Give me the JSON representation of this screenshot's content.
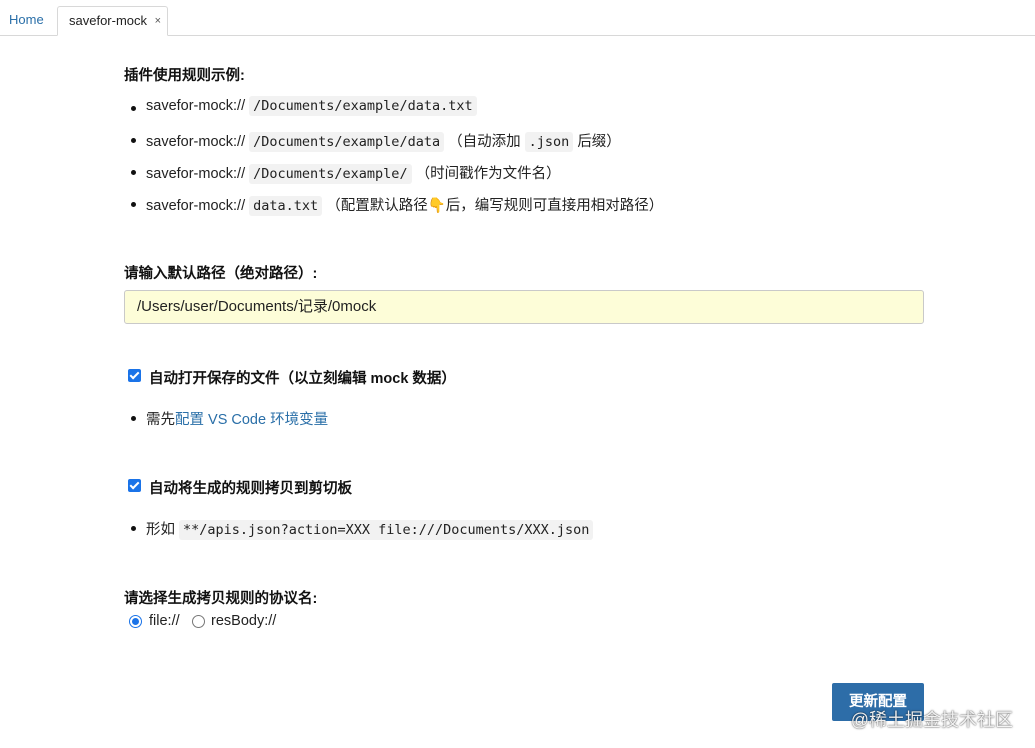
{
  "tabs": {
    "home": "Home",
    "active": "savefor-mock",
    "close": "×"
  },
  "examples": {
    "heading": "插件使用规则示例:",
    "items": [
      {
        "prefix": "savefor-mock://",
        "code": "/Documents/example/data.txt",
        "note": "",
        "code2": "",
        "note2": ""
      },
      {
        "prefix": "savefor-mock://",
        "code": "/Documents/example/data",
        "note": "（自动添加",
        "code2": ".json",
        "note2": "后缀）"
      },
      {
        "prefix": "savefor-mock://",
        "code": "/Documents/example/",
        "note": "（时间戳作为文件名）",
        "code2": "",
        "note2": ""
      },
      {
        "prefix": "savefor-mock://",
        "code": "data.txt",
        "note": "（配置默认路径👇后，编写规则可直接用相对路径）",
        "code2": "",
        "note2": ""
      }
    ]
  },
  "default_path": {
    "label": "请输入默认路径（绝对路径）:",
    "value": "/Users/user/Documents/记录/0mock"
  },
  "auto_open": {
    "label": "自动打开保存的文件（以立刻编辑 mock 数据）",
    "checked": true,
    "hint_prefix": "需先",
    "hint_link": "配置 VS Code 环境变量"
  },
  "auto_copy": {
    "label": "自动将生成的规则拷贝到剪切板",
    "checked": true,
    "hint_prefix": "形如",
    "hint_code": "**/apis.json?action=XXX file:///Documents/XXX.json"
  },
  "protocol": {
    "label": "请选择生成拷贝规则的协议名:",
    "options": [
      {
        "label": "file://",
        "selected": true
      },
      {
        "label": "resBody://",
        "selected": false
      }
    ]
  },
  "update_button": "更新配置",
  "watermark": "@稀土掘金技术社区",
  "colors": {
    "accent": "#1a73e8",
    "button": "#2d6da8",
    "link": "#2a6fa8",
    "input_bg": "#fdfdd8"
  }
}
